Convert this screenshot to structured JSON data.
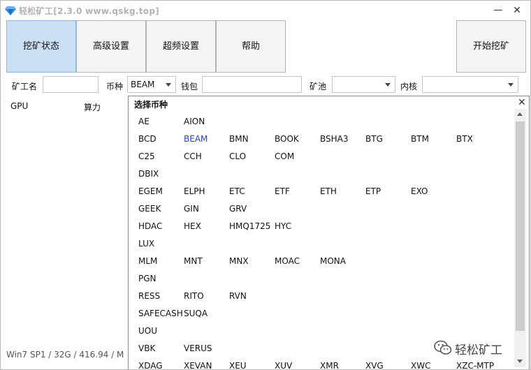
{
  "window": {
    "title": "轻松矿工[2.3.0 www.qskg.top]",
    "minimize_glyph": "—",
    "close_glyph": "✕"
  },
  "toolbar": {
    "mining_status": "挖矿状态",
    "advanced": "高级设置",
    "overclock": "超频设置",
    "help": "帮助",
    "start_mining": "开始挖矿"
  },
  "form": {
    "miner_label": "矿工名",
    "miner_value": "",
    "coin_label": "币种",
    "coin_value": "BEAM",
    "wallet_label": "钱包",
    "wallet_value": "",
    "pool_label": "矿池",
    "pool_value": "",
    "kernel_label": "内核",
    "kernel_value": ""
  },
  "gpu_table": {
    "col_gpu": "GPU",
    "col_hashrate": "算力"
  },
  "status_text": "Win7 SP1 / 32G / 416.94 / M",
  "coin_popup": {
    "title": "选择币种",
    "close_glyph": "✕",
    "rows": [
      [
        "AE",
        "AION"
      ],
      [
        "BCD",
        "BEAM",
        "BMN",
        "BOOK",
        "BSHA3",
        "BTG",
        "BTM",
        "BTX"
      ],
      [
        "C25",
        "CCH",
        "CLO",
        "COM"
      ],
      [
        "DBIX"
      ],
      [
        "EGEM",
        "ELPH",
        "ETC",
        "ETF",
        "ETH",
        "ETP",
        "EXO"
      ],
      [
        "GEEK",
        "GIN",
        "GRV"
      ],
      [
        "HDAC",
        "HEX",
        "HMQ1725",
        "HYC"
      ],
      [
        "LUX"
      ],
      [
        "MLM",
        "MNT",
        "MNX",
        "MOAC",
        "MONA"
      ],
      [
        "PGN"
      ],
      [
        "RESS",
        "RITO",
        "RVN"
      ],
      [
        "SAFECASH",
        "SUQA"
      ],
      [
        "UOU"
      ],
      [
        "VBK",
        "VERUS"
      ],
      [
        "XDAG",
        "XEVAN",
        "XEU",
        "XUV",
        "XMR",
        "XVG",
        "XWC",
        "XZC-MTP"
      ]
    ],
    "selected": "BEAM"
  },
  "watermark": {
    "text": "轻松矿工"
  },
  "colors": {
    "active_tab": "#c9e0f7",
    "selected_coin": "#2a3ec8"
  }
}
